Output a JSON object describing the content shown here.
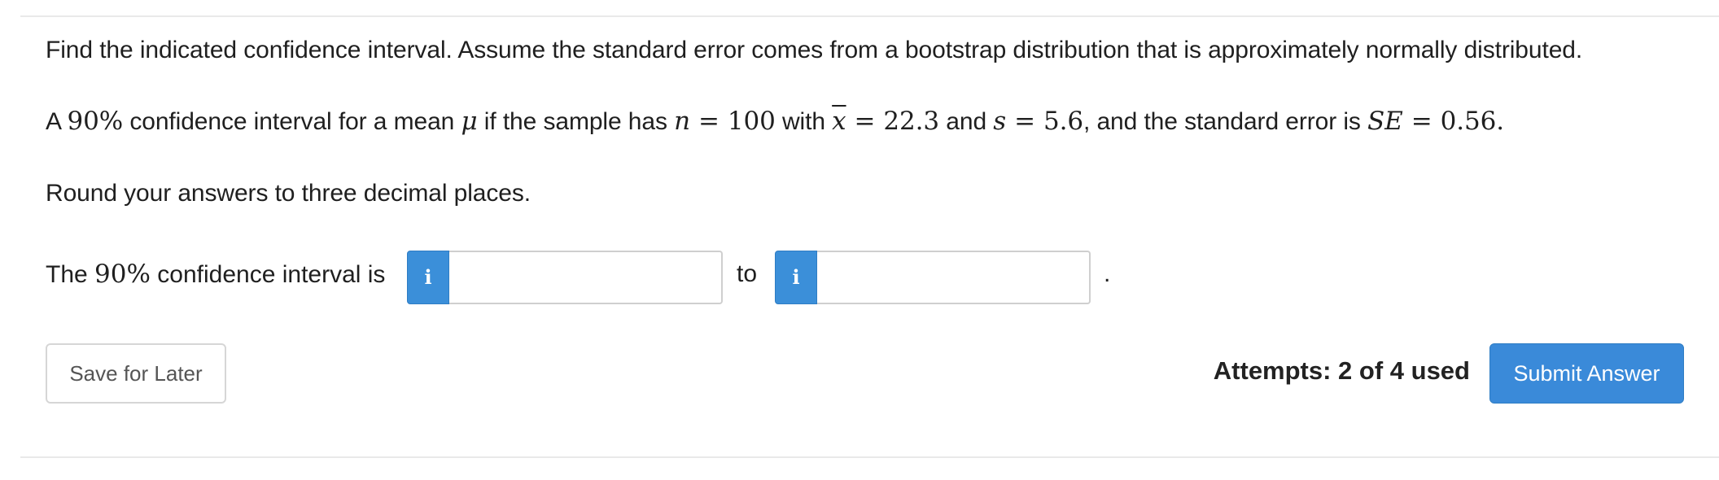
{
  "question": {
    "instruction": "Find the indicated confidence interval. Assume the standard error comes from a bootstrap distribution that is approximately normally distributed.",
    "problem": {
      "part_a": "A ",
      "confidence": "90%",
      "part_b": " confidence interval for a mean ",
      "mu": "μ",
      "part_c": " if the sample has ",
      "n_var": "n",
      "eq": "=",
      "n_value": "100",
      "part_d": " with ",
      "xbar_var": "x",
      "xbar_value": "22.3",
      "part_e": " and ",
      "s_var": "s",
      "s_value": "5.6",
      "part_f": ", and the standard error is ",
      "se_var": "SE",
      "se_value": "0.56",
      "end": "."
    },
    "rounding": "Round your answers to three decimal places."
  },
  "answer": {
    "label_prefix": "The ",
    "label_confidence": "90%",
    "label_suffix": " confidence interval is",
    "info_icon": "i",
    "to_label": "to",
    "period": ".",
    "lower_value": "",
    "upper_value": ""
  },
  "footer": {
    "save_label": "Save for Later",
    "attempts": "Attempts: 2 of 4 used",
    "submit_label": "Submit Answer"
  },
  "colors": {
    "accent": "#3a8ad9",
    "border": "#cfcfcf",
    "rule": "#e9e9e9"
  },
  "icons": {
    "info": "info-icon"
  }
}
